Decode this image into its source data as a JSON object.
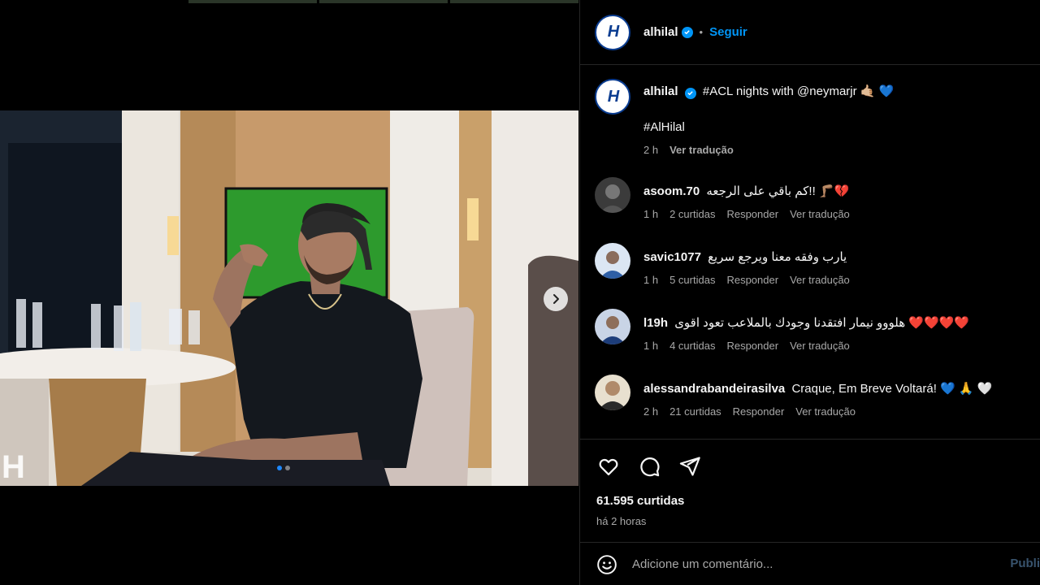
{
  "post": {
    "account": "alhilal",
    "follow_label": "Seguir",
    "bullet": "•",
    "avatar_initials": "H",
    "caption_text": "#ACL nights with @neymarjr 🤙🏼 💙",
    "caption_tags": "#AlHilal",
    "caption_time": "2 h",
    "caption_translate": "Ver tradução"
  },
  "comments": [
    {
      "user": "asoom.70",
      "text": "كم باقي على الرجعه!! 🦵🏽💔",
      "time": "1 h",
      "likes": "2 curtidas",
      "reply": "Responder",
      "translate": "Ver tradução"
    },
    {
      "user": "savic1077",
      "text": "يارب وفقه معنا ويرجع سريع",
      "time": "1 h",
      "likes": "5 curtidas",
      "reply": "Responder",
      "translate": "Ver tradução"
    },
    {
      "user": "l19h",
      "text": "هلووو نيمار افتقدنا وجودك بالملاعب تعود اقوى ❤️❤️❤️❤️",
      "time": "1 h",
      "likes": "4 curtidas",
      "reply": "Responder",
      "translate": "Ver tradução"
    },
    {
      "user": "alessandrabandeirasilva",
      "text": "Craque, Em Breve Voltará! 💙 🙏 🤍",
      "time": "2 h",
      "likes": "21 curtidas",
      "reply": "Responder",
      "translate": "Ver tradução"
    }
  ],
  "stats": {
    "likes": "61.595 curtidas",
    "posted": "há 2 horas"
  },
  "composer": {
    "placeholder": "Adicione um comentário...",
    "publish": "Publi"
  },
  "carousel": {
    "slide_count": 2,
    "active_index": 0
  },
  "colors": {
    "accent": "#0095f6",
    "background": "#000000",
    "border": "#262626",
    "muted_text": "#a8a8a8"
  },
  "icons": [
    "like-icon",
    "comment-icon",
    "share-icon",
    "emoji-icon",
    "chevron-right-icon",
    "verified-icon"
  ]
}
